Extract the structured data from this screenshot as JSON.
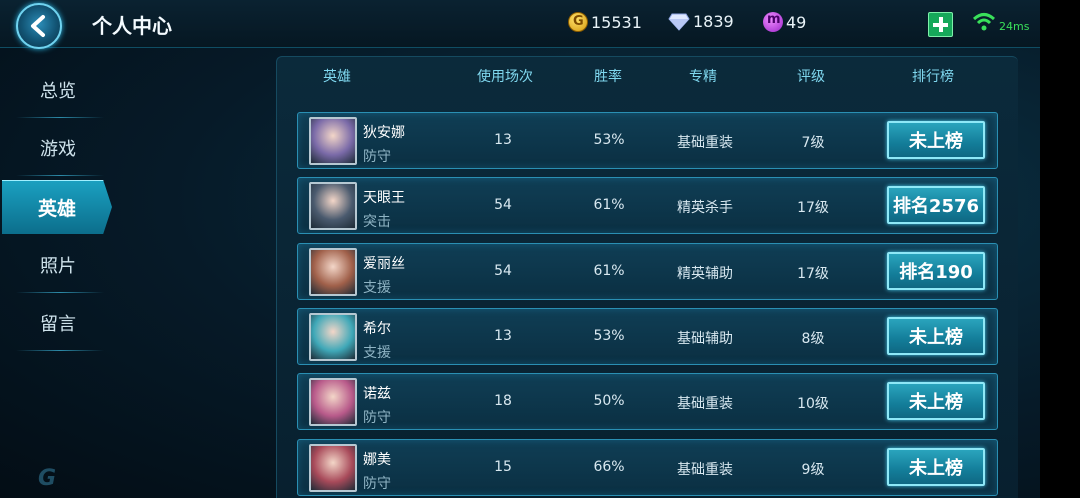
{
  "header": {
    "title": "个人中心",
    "gold": "15531",
    "diamond": "1839",
    "points": "49",
    "ping": "24ms"
  },
  "sidebar": {
    "items": [
      {
        "label": "总览"
      },
      {
        "label": "游戏"
      },
      {
        "label": "英雄"
      },
      {
        "label": "照片"
      },
      {
        "label": "留言"
      }
    ],
    "active": "英雄"
  },
  "table": {
    "headers": [
      "英雄",
      "使用场次",
      "胜率",
      "专精",
      "评级",
      "排行榜"
    ],
    "rows": [
      {
        "name": "狄安娜",
        "role": "防守",
        "games": "13",
        "winrate": "53%",
        "spec": "基础重装",
        "grade": "7级",
        "rank": "未上榜",
        "portrait_color": "#7a6aa8"
      },
      {
        "name": "天眼王",
        "role": "突击",
        "games": "54",
        "winrate": "61%",
        "spec": "精英杀手",
        "grade": "17级",
        "rank": "排名2576",
        "portrait_color": "#4a5a6e"
      },
      {
        "name": "爱丽丝",
        "role": "支援",
        "games": "54",
        "winrate": "61%",
        "spec": "精英辅助",
        "grade": "17级",
        "rank": "排名190",
        "portrait_color": "#a0604a"
      },
      {
        "name": "希尔",
        "role": "支援",
        "games": "13",
        "winrate": "53%",
        "spec": "基础辅助",
        "grade": "8级",
        "rank": "未上榜",
        "portrait_color": "#3fa8b8"
      },
      {
        "name": "诺兹",
        "role": "防守",
        "games": "18",
        "winrate": "50%",
        "spec": "基础重装",
        "grade": "10级",
        "rank": "未上榜",
        "portrait_color": "#b85a8a"
      },
      {
        "name": "娜美",
        "role": "防守",
        "games": "15",
        "winrate": "66%",
        "spec": "基础重装",
        "grade": "9级",
        "rank": "未上榜",
        "portrait_color": "#a84a5a"
      }
    ]
  },
  "colors": {
    "accent": "#2aa4bd",
    "row_border": "#2a8fb3",
    "header_text": "#7fd7ee"
  }
}
